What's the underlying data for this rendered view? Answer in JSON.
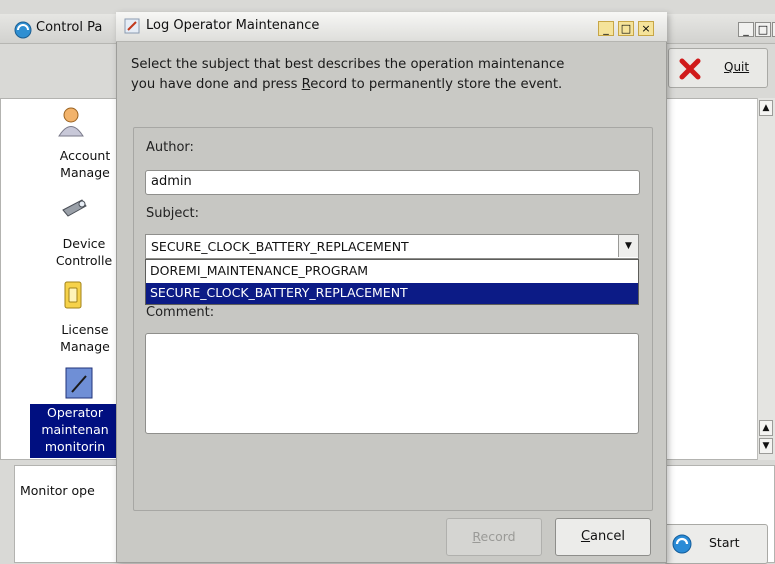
{
  "background_window": {
    "title": "Control Pa",
    "quit_label": "Quit",
    "start_label": "Start",
    "monitor_label": "Monitor ope",
    "sidebar": {
      "items": [
        {
          "line1": "Account",
          "line2": "Manage",
          "icon": "user-icon"
        },
        {
          "line1": "Device",
          "line2": "Controlle",
          "icon": "projector-icon"
        },
        {
          "line1": "License",
          "line2": "Manage",
          "icon": "key-icon"
        },
        {
          "line1": "Operator",
          "line2": "maintenan",
          "line3": "monitorin",
          "icon": "notepad-icon",
          "selected": true
        }
      ]
    }
  },
  "dialog": {
    "title": "Log Operator Maintenance",
    "instructions_line1": "Select the subject that best describes the operation maintenance",
    "instructions_line2_pre": "you have done and press ",
    "instructions_line2_key": "R",
    "instructions_line2_post": "ecord to permanently store the event.",
    "author_label": "Author:",
    "author_value": "admin",
    "subject_label": "Subject:",
    "subject_value": "SECURE_CLOCK_BATTERY_REPLACEMENT",
    "subject_options": [
      "DOREMI_MAINTENANCE_PROGRAM",
      "SECURE_CLOCK_BATTERY_REPLACEMENT"
    ],
    "highlighted_option_index": 1,
    "comment_label": "Comment:",
    "comment_value": "",
    "record_key": "R",
    "record_rest": "ecord",
    "cancel_key": "C",
    "cancel_rest": "ancel"
  },
  "colors": {
    "selection": "#0c1b86",
    "dialog_bg": "#c9c9c5",
    "titlebar_buttons": "#f5e39a"
  }
}
